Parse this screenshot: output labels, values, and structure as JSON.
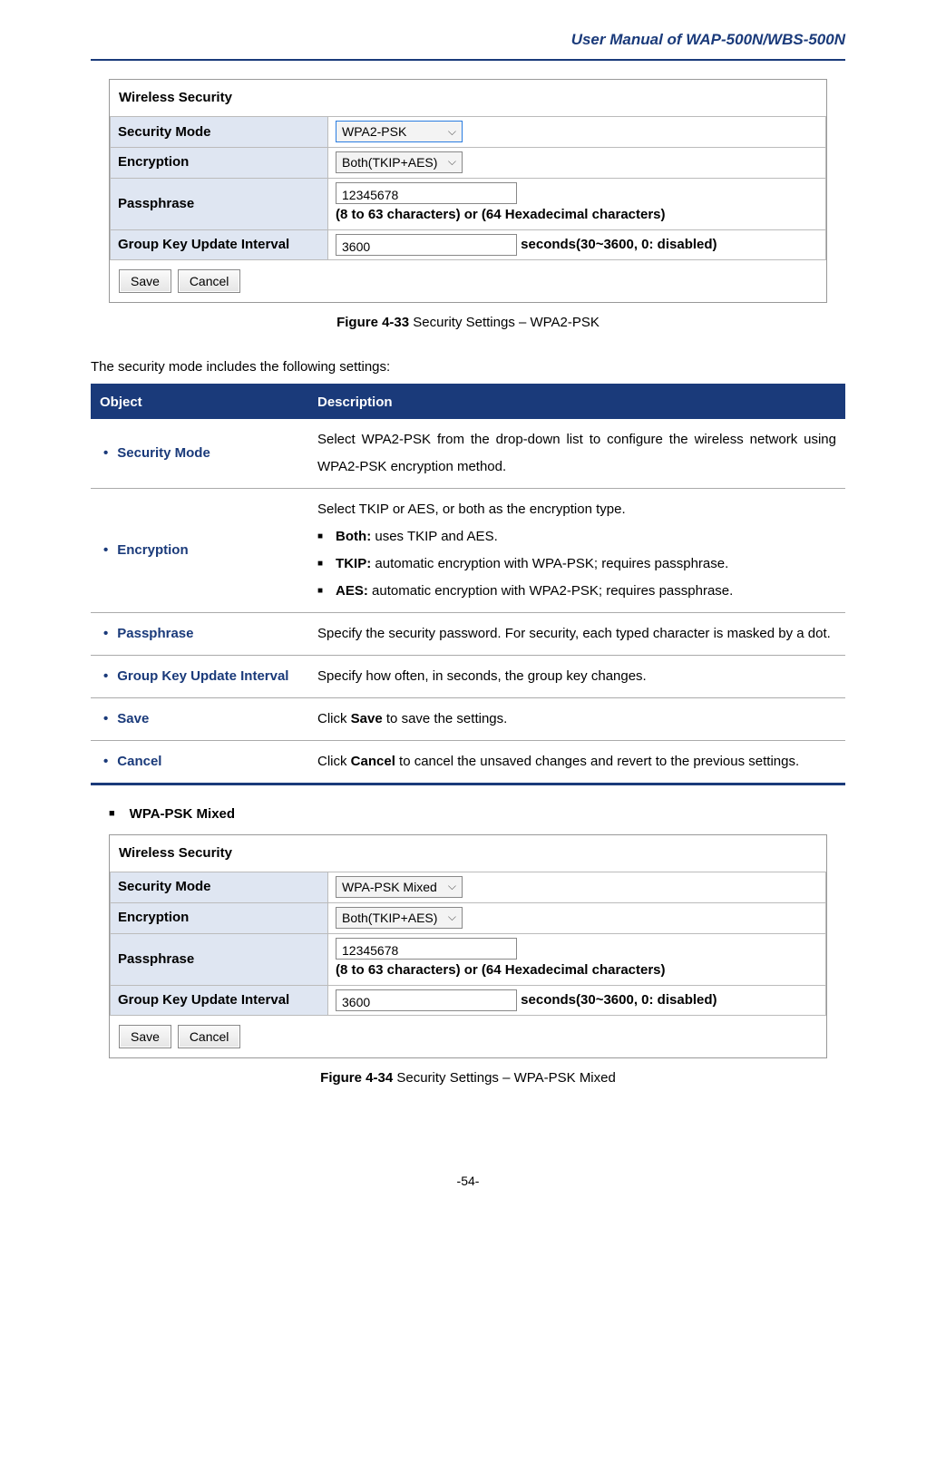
{
  "header": {
    "title": "User Manual of WAP-500N/WBS-500N"
  },
  "panel1": {
    "title": "Wireless Security",
    "rows": {
      "security_mode": {
        "label": "Security Mode",
        "value": "WPA2-PSK"
      },
      "encryption": {
        "label": "Encryption",
        "value": "Both(TKIP+AES)"
      },
      "passphrase": {
        "label": "Passphrase",
        "value": "12345678",
        "hint": "(8 to 63 characters) or (64 Hexadecimal characters)"
      },
      "interval": {
        "label": "Group Key Update Interval",
        "value": "3600",
        "hint": "seconds(30~3600, 0: disabled)"
      }
    },
    "buttons": {
      "save": "Save",
      "cancel": "Cancel"
    }
  },
  "caption1": {
    "label": "Figure 4-33",
    "text": " Security Settings – WPA2-PSK"
  },
  "intro": "The security mode includes the following settings:",
  "desc_table": {
    "headers": {
      "object": "Object",
      "description": "Description"
    },
    "rows": [
      {
        "object": "Security Mode",
        "desc": "Select WPA2-PSK from the drop-down list to configure the wireless network using WPA2-PSK encryption method."
      },
      {
        "object": "Encryption",
        "desc_intro": "Select TKIP or AES, or both as the encryption type.",
        "sub": [
          {
            "b": "Both:",
            "t": " uses TKIP and AES."
          },
          {
            "b": "TKIP:",
            "t": " automatic encryption with WPA-PSK; requires passphrase."
          },
          {
            "b": "AES:",
            "t": " automatic encryption with WPA2-PSK; requires passphrase."
          }
        ]
      },
      {
        "object": "Passphrase",
        "desc": "Specify the security password. For security, each typed character is masked by a dot."
      },
      {
        "object": "Group Key Update Interval",
        "desc": "Specify how often, in seconds, the group key changes."
      },
      {
        "object": "Save",
        "desc_pre": "Click ",
        "desc_bold": "Save",
        "desc_post": " to save the settings."
      },
      {
        "object": "Cancel",
        "desc_pre": "Click ",
        "desc_bold": "Cancel",
        "desc_post": " to cancel the unsaved changes and revert to the previous settings."
      }
    ]
  },
  "section2_header": "WPA-PSK Mixed",
  "panel2": {
    "title": "Wireless Security",
    "rows": {
      "security_mode": {
        "label": "Security Mode",
        "value": "WPA-PSK Mixed"
      },
      "encryption": {
        "label": "Encryption",
        "value": "Both(TKIP+AES)"
      },
      "passphrase": {
        "label": "Passphrase",
        "value": "12345678",
        "hint": "(8 to 63 characters) or (64 Hexadecimal characters)"
      },
      "interval": {
        "label": "Group Key Update Interval",
        "value": "3600",
        "hint": "seconds(30~3600, 0: disabled)"
      }
    },
    "buttons": {
      "save": "Save",
      "cancel": "Cancel"
    }
  },
  "caption2": {
    "label": "Figure 4-34",
    "text": " Security Settings – WPA-PSK Mixed"
  },
  "page_number": "-54-"
}
